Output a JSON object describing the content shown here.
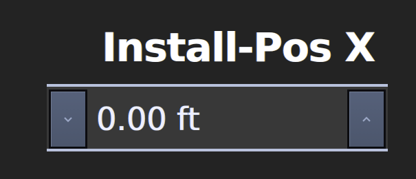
{
  "label": "Install-Pos X",
  "spinner": {
    "value_text": "0.00 ft",
    "decrement_icon": "chevron-down-icon",
    "increment_icon": "chevron-up-icon"
  },
  "colors": {
    "background": "#232323",
    "field_background": "#383838",
    "field_border": "#b8c1dc",
    "button_fill": "#4c566c",
    "text": "#ffffff"
  }
}
